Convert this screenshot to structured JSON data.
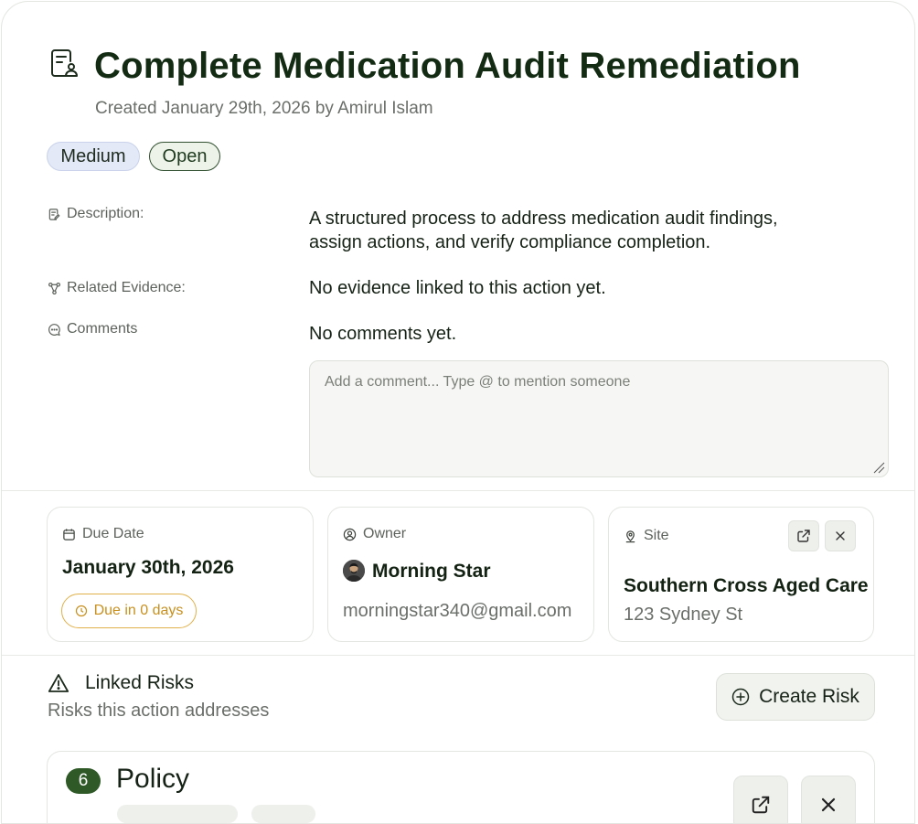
{
  "header": {
    "title": "Complete Medication Audit Remediation",
    "subtitle": "Created January 29th, 2026 by Amirul Islam",
    "icon": "document-user-icon"
  },
  "badges": {
    "priority": "Medium",
    "status": "Open"
  },
  "fields": {
    "description_label": "Description:",
    "description_line1": "A structured process to address medication audit findings,",
    "description_line2": "assign actions, and verify compliance completion.",
    "evidence_label": "Related Evidence:",
    "evidence_value": "No evidence linked to this action yet.",
    "comments_label": "Comments",
    "comments_value": "No comments yet.",
    "comment_placeholder": "Add a comment... Type @ to mention someone"
  },
  "cards": {
    "due": {
      "label": "Due Date",
      "date": "January 30th, 2026",
      "pill": "Due in 0 days"
    },
    "owner": {
      "label": "Owner",
      "name": "Morning Star",
      "email": "morningstar340@gmail.com"
    },
    "site": {
      "label": "Site",
      "name": "Southern Cross Aged Care",
      "address": "123 Sydney St"
    }
  },
  "risks": {
    "title": "Linked Risks",
    "subtitle": "Risks this action addresses",
    "create_label": "Create Risk",
    "items": [
      {
        "number": "6",
        "name": "Policy"
      }
    ]
  },
  "colors": {
    "title": "#132a13",
    "accent_green": "#2f5a28",
    "due_amber": "#c8901f",
    "priority_bg": "#e3e9f7"
  }
}
